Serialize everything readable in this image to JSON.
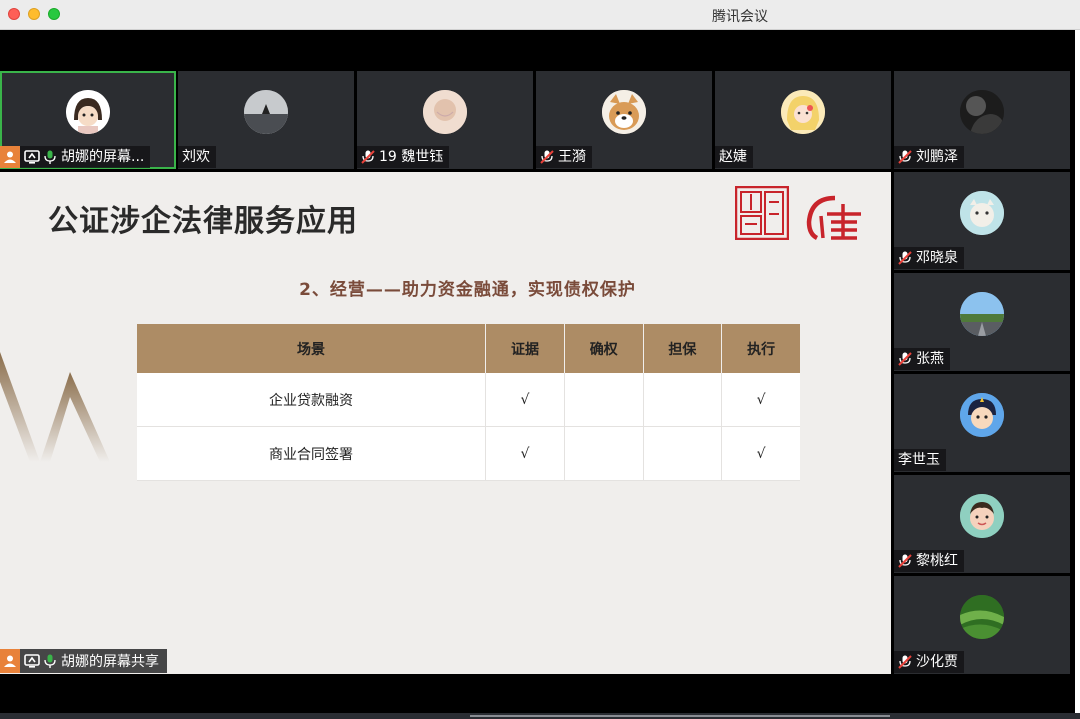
{
  "window": {
    "title": "腾讯会议"
  },
  "participants": [
    {
      "name": "胡娜的屏幕...",
      "mic": "on",
      "sharing": true
    },
    {
      "name": "刘欢",
      "mic": "none"
    },
    {
      "name": "19 魏世钰",
      "mic": "muted"
    },
    {
      "name": "王漪",
      "mic": "muted"
    },
    {
      "name": "赵婕",
      "mic": "none"
    },
    {
      "name": "刘鹏泽",
      "mic": "muted"
    },
    {
      "name": "邓晓泉",
      "mic": "muted"
    },
    {
      "name": "张燕",
      "mic": "muted"
    },
    {
      "name": "李世玉",
      "mic": "none"
    },
    {
      "name": "黎桃红",
      "mic": "muted"
    },
    {
      "name": "沙化贾",
      "mic": "muted"
    }
  ],
  "slide": {
    "title": "公证涉企法律服务应用",
    "subtitle": "2、经营——助力资金融通，实现债权保护",
    "table": {
      "headers": [
        "场景",
        "证据",
        "确权",
        "担保",
        "执行"
      ],
      "rows": [
        [
          "企业贷款融资",
          "√",
          "",
          "",
          "√"
        ],
        [
          "商业合同签署",
          "√",
          "",
          "",
          "√"
        ]
      ]
    }
  },
  "share_bar": {
    "label": "胡娜的屏幕共享"
  },
  "colors": {
    "slide_bg": "#f0eeec",
    "table_header": "#ad8c65",
    "subtitle": "#7a4b3a",
    "accent_red": "#c8242b",
    "active_border": "#3ab44a"
  }
}
